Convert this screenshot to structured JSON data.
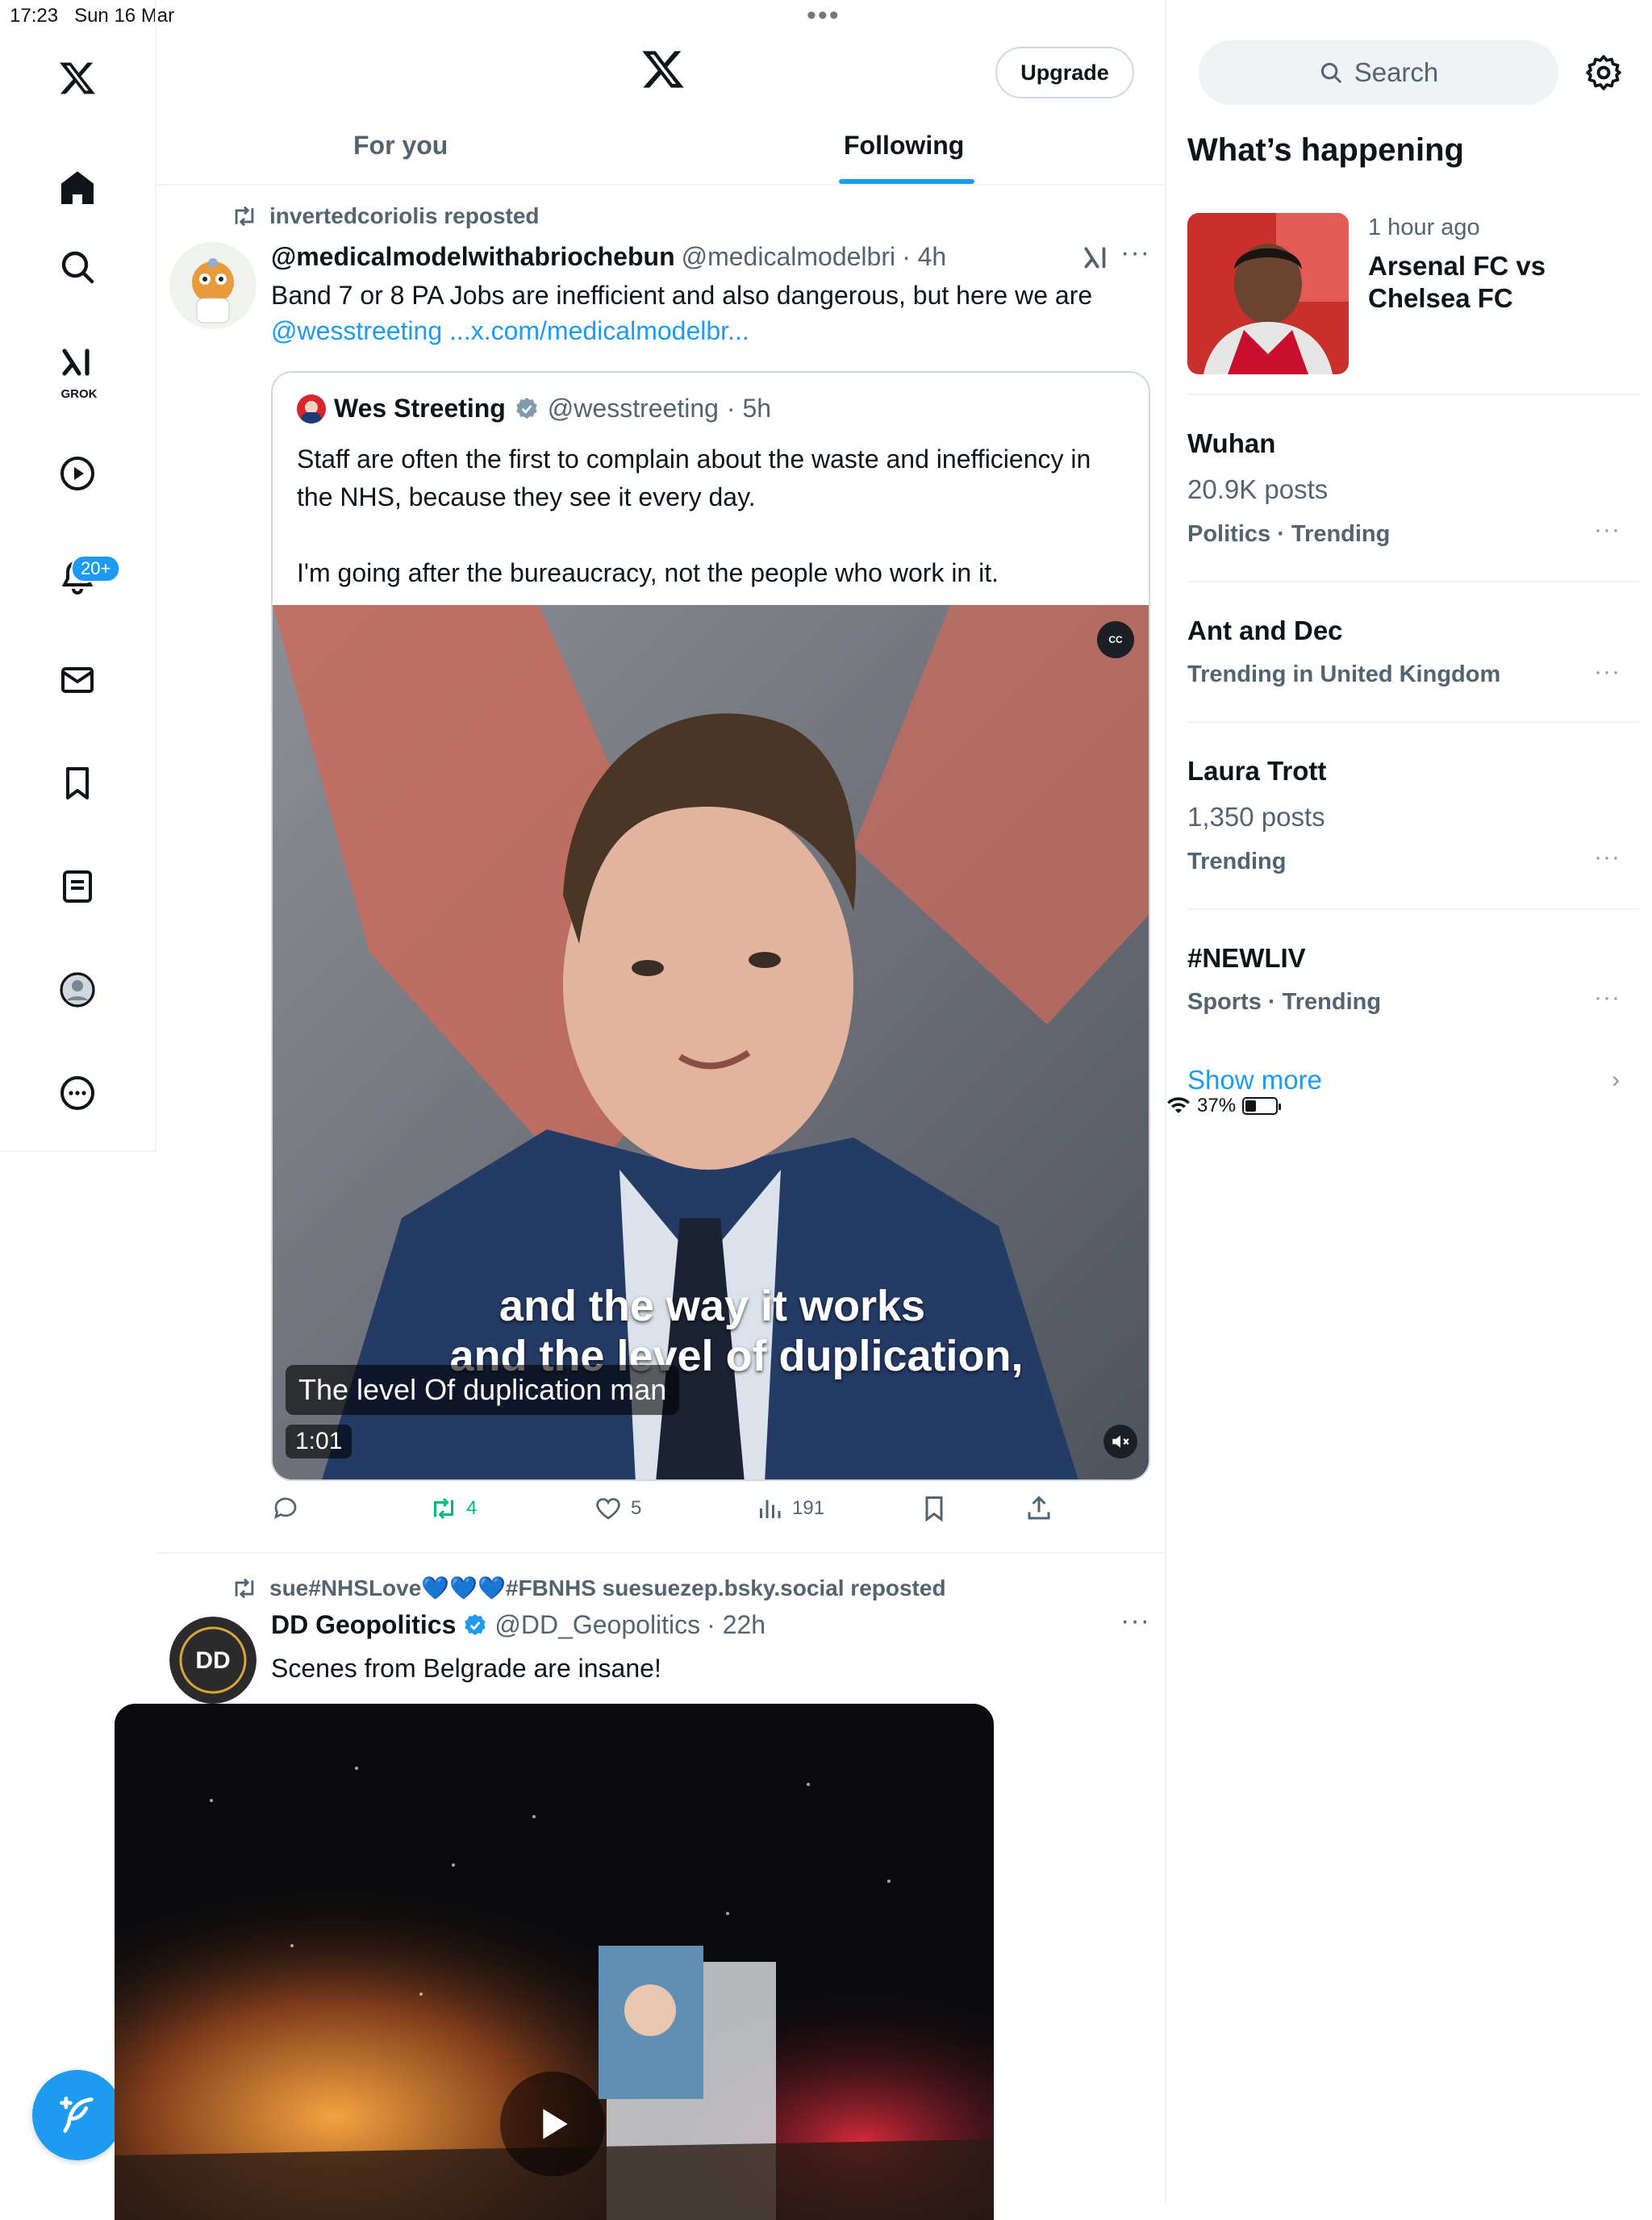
{
  "status_bar": {
    "time": "17:23",
    "date": "Sun 16 Mar",
    "battery": "37%",
    "battery_level": 0.37
  },
  "nav": {
    "items": [
      {
        "icon": "x-logo-icon"
      },
      {
        "icon": "home-icon"
      },
      {
        "icon": "search-icon"
      },
      {
        "icon": "grok-icon",
        "label": "GROK"
      },
      {
        "icon": "video-play-icon"
      },
      {
        "icon": "bell-icon",
        "badge": "20+"
      },
      {
        "icon": "mail-icon"
      },
      {
        "icon": "bookmark-icon"
      },
      {
        "icon": "list-icon"
      },
      {
        "icon": "profile-icon"
      },
      {
        "icon": "more-circle-icon"
      }
    ],
    "compose_icon": "compose-feather-icon"
  },
  "header": {
    "upgrade_label": "Upgrade"
  },
  "tabs": [
    {
      "label": "For you"
    },
    {
      "label": "Following"
    }
  ],
  "tweets": [
    {
      "reposted_by": "invertedcoriolis reposted",
      "name": "@medicalmodelwithabriochebun",
      "handle": "@medicalmodelbri",
      "time": "· 4h",
      "text": "Band 7 or 8 PA Jobs are inefficient and also dangerous, but here we are",
      "mention": "@wesstreeting",
      "link": "...x.com/medicalmodelbr...",
      "quote": {
        "name": "Wes Streeting",
        "handle": "@wesstreeting",
        "time": "· 5h",
        "text": "Staff are often the first to complain about the waste and inefficiency in the NHS, because they see it every day.\n\nI'm going after the bureaucracy, not the people who work in it.",
        "video": {
          "burned_line1": "and the way it works",
          "burned_line2": "and the level of duplication,",
          "caption": "The level Of duplication man",
          "duration": "1:01"
        }
      },
      "stats": {
        "reposts": "4",
        "likes": "5",
        "views": "191"
      }
    },
    {
      "reposted_by": "sue#NHSLove💙💙💙#FBNHS suesuezep.bsky.social reposted",
      "name": "DD Geopolitics",
      "handle": "@DD_Geopolitics",
      "time": "· 22h",
      "text": "Scenes from Belgrade are insane!"
    }
  ],
  "sidebar": {
    "search_placeholder": "Search",
    "whats_happening": "What’s happening",
    "featured": {
      "meta": "1 hour ago",
      "title": "Arsenal FC vs Chelsea FC"
    },
    "trends": [
      {
        "title": "Wuhan",
        "posts": "20.9K posts",
        "category": "Politics · Trending"
      },
      {
        "title": "Ant and Dec",
        "category": "Trending in United Kingdom"
      },
      {
        "title": "Laura Trott",
        "posts": "1,350 posts",
        "category": "Trending"
      },
      {
        "title": "#NEWLIV",
        "category": "Sports · Trending"
      }
    ],
    "show_more": "Show more"
  },
  "colors": {
    "accent": "#1d9bf0",
    "repost_green": "#00ba7c",
    "text": "#0f1419",
    "muted": "#536471"
  }
}
